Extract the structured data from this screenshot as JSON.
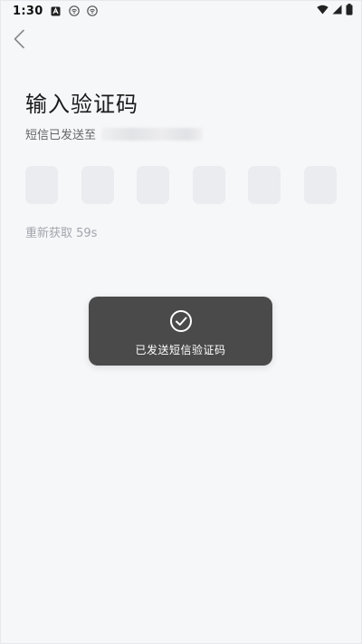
{
  "status_bar": {
    "time": "1:30",
    "icons_left": [
      "notification-a-icon",
      "wifi-circle-icon",
      "wifi-circle-icon"
    ],
    "icons_right": [
      "wifi-icon",
      "signal-icon",
      "battery-icon"
    ]
  },
  "header": {
    "back_icon": "chevron-left-icon"
  },
  "main": {
    "title": "输入验证码",
    "sms_sent_prefix": "短信已发送至",
    "code_length": 6,
    "resend_text": "重新获取 59s"
  },
  "toast": {
    "icon": "check-circle-icon",
    "message": "已发送短信验证码"
  },
  "colors": {
    "background": "#f6f7f9",
    "code_box": "#ebecef",
    "toast_bg": "#4a4a4a",
    "muted_text": "#a3a5ab"
  }
}
